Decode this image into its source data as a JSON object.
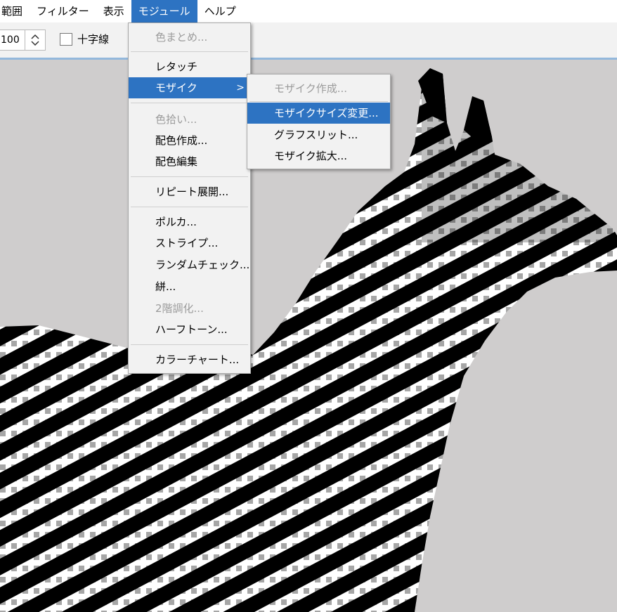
{
  "menubar": {
    "items": [
      "範囲",
      "フィルター",
      "表示",
      "モジュール",
      "ヘルプ"
    ],
    "active_index": 3
  },
  "toolbar": {
    "zoom_value": "100",
    "crosshair_label": "十字線",
    "crosshair_checked": false
  },
  "module_menu": {
    "items": [
      {
        "label": "色まとめ...",
        "disabled": true
      },
      {
        "label": "レタッチ",
        "disabled": false
      },
      {
        "label": "モザイク",
        "disabled": false,
        "submenu": true,
        "highlighted": true
      },
      {
        "label": "色拾い...",
        "disabled": true
      },
      {
        "label": "配色作成...",
        "disabled": false
      },
      {
        "label": "配色編集",
        "disabled": false
      },
      {
        "label": "リピート展開...",
        "disabled": false
      },
      {
        "label": "ポルカ...",
        "disabled": false
      },
      {
        "label": "ストライプ...",
        "disabled": false
      },
      {
        "label": "ランダムチェック...",
        "disabled": false
      },
      {
        "label": "絣...",
        "disabled": false
      },
      {
        "label": "2階調化...",
        "disabled": true
      },
      {
        "label": "ハーフトーン...",
        "disabled": false
      },
      {
        "label": "カラーチャート...",
        "disabled": false
      }
    ],
    "submenu_arrow": ">"
  },
  "mosaic_submenu": {
    "items": [
      {
        "label": "モザイク作成...",
        "disabled": true
      },
      {
        "label": "モザイクサイズ変更...",
        "disabled": false,
        "highlighted": true
      },
      {
        "label": "グラフスリット...",
        "disabled": false
      },
      {
        "label": "モザイク拡大...",
        "disabled": false
      }
    ]
  },
  "colors": {
    "accent": "#2d73c2",
    "canvas_bg": "#cfcdcd",
    "menu_bg": "#f2f2f2",
    "disabled_text": "#9b9b9b"
  }
}
